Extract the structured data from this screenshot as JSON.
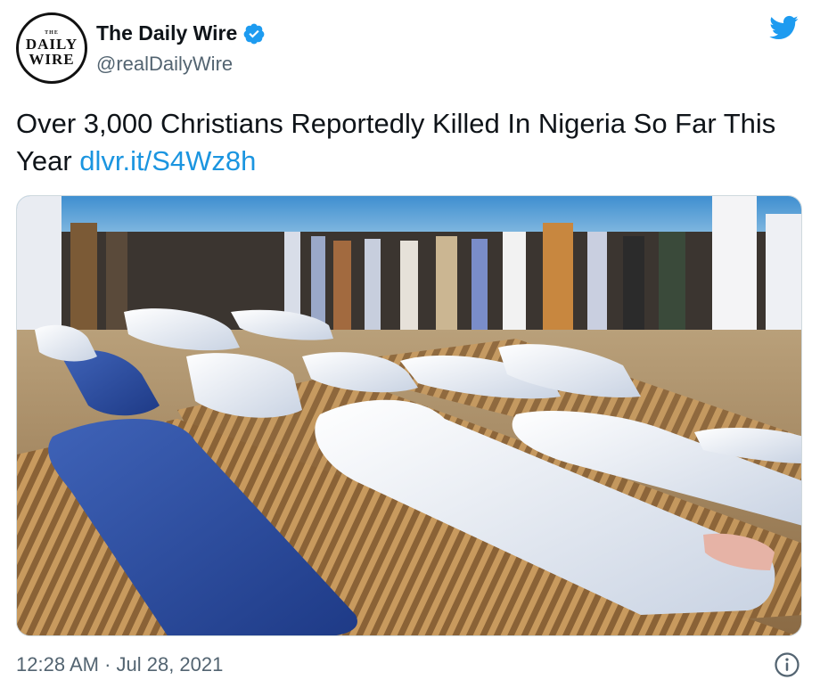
{
  "author": {
    "name": "The Daily Wire",
    "handle": "@realDailyWire",
    "avatar_small_text": "THE",
    "avatar_line1": "DAILY",
    "avatar_line2": "WIRE",
    "verified": true
  },
  "tweet": {
    "text": "Over 3,000 Christians Reportedly Killed In Nigeria So Far This Year",
    "link": "dlvr.it/S4Wz8h"
  },
  "footer": {
    "timestamp": "12:28 AM · Jul 28, 2021"
  },
  "icons": {
    "brand": "twitter-bird-icon",
    "verified": "verified-badge-icon",
    "info": "info-icon"
  },
  "colors": {
    "twitter_blue": "#1d9bf0",
    "link_blue": "#1b95e0",
    "secondary_text": "#536471"
  }
}
